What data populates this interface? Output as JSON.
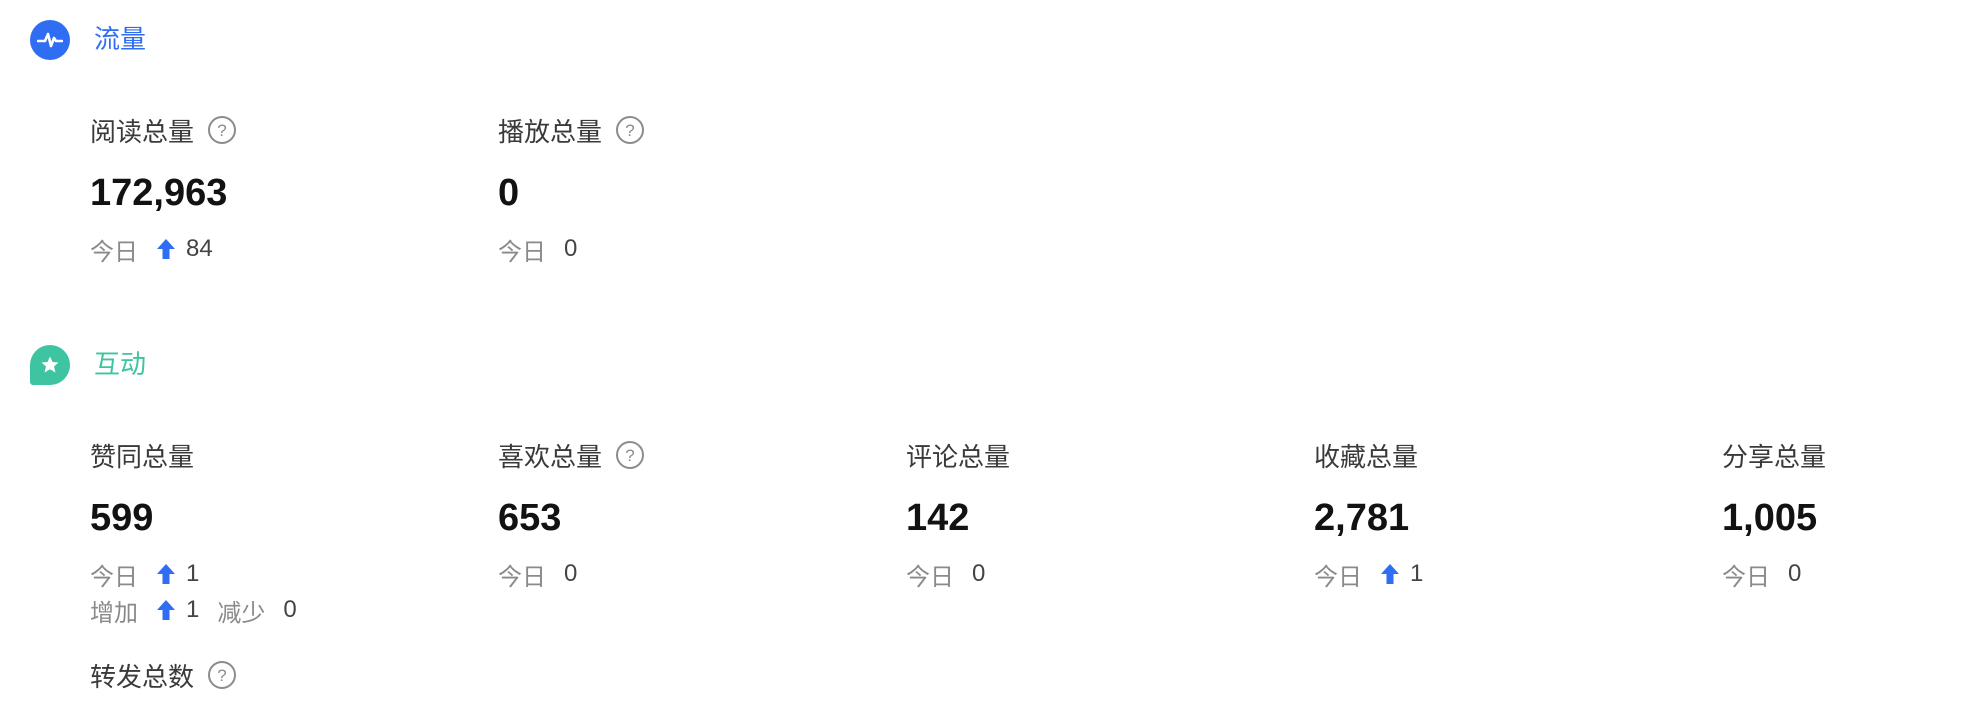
{
  "sections": {
    "traffic": {
      "title": "流量",
      "icon": "pulse-icon",
      "color": "#2f6ef2"
    },
    "interaction": {
      "title": "互动",
      "icon": "star-chat-icon",
      "color": "#3ec4a0"
    }
  },
  "today_label": "今日",
  "increase_label": "增加",
  "decrease_label": "减少",
  "metrics": {
    "read": {
      "label": "阅读总量",
      "value": "172,963",
      "today": "84",
      "today_up": true,
      "has_help": true
    },
    "play": {
      "label": "播放总量",
      "value": "0",
      "today": "0",
      "today_up": false,
      "has_help": true
    },
    "like": {
      "label": "赞同总量",
      "value": "599",
      "today": "1",
      "today_up": true,
      "has_help": false,
      "increase": "1",
      "decrease": "0"
    },
    "fav": {
      "label": "喜欢总量",
      "value": "653",
      "today": "0",
      "today_up": false,
      "has_help": true
    },
    "comment": {
      "label": "评论总量",
      "value": "142",
      "today": "0",
      "today_up": false,
      "has_help": false
    },
    "collect": {
      "label": "收藏总量",
      "value": "2,781",
      "today": "1",
      "today_up": true,
      "has_help": false
    },
    "share": {
      "label": "分享总量",
      "value": "1,005",
      "today": "0",
      "today_up": false,
      "has_help": false
    },
    "forward": {
      "label": "转发总数",
      "has_help": true
    }
  },
  "help_glyph": "?",
  "colors": {
    "arrow_up": "#2f6ef2",
    "text_primary": "#121212",
    "text_muted": "#8a8a8a"
  }
}
